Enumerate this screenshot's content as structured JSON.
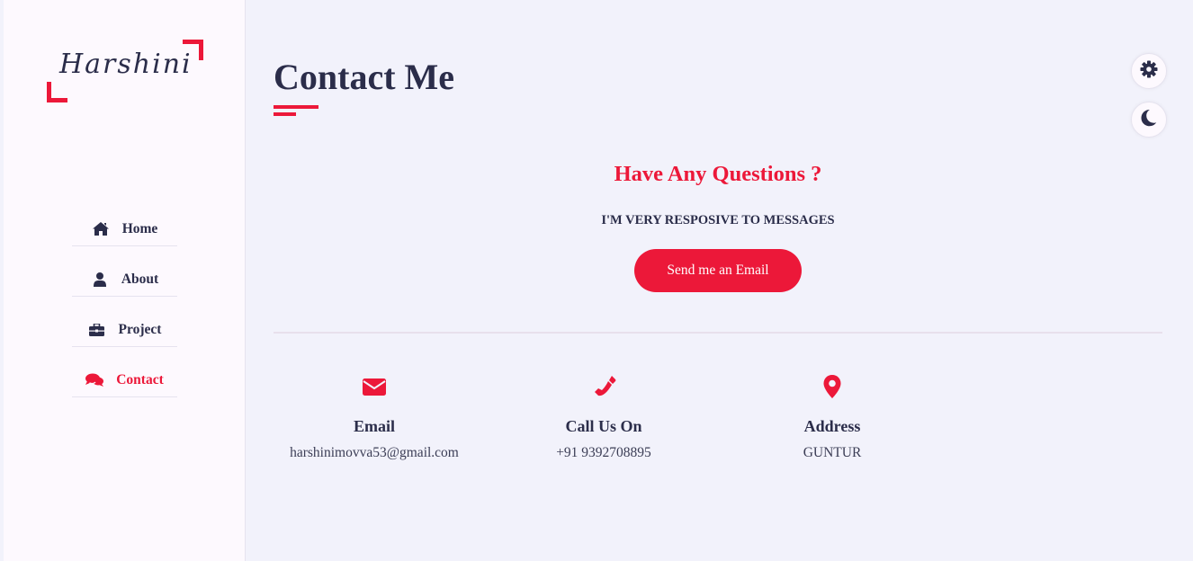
{
  "brand": {
    "logo_text": "Harshini"
  },
  "sidebar": {
    "items": [
      {
        "label": "Home",
        "icon": "home-icon"
      },
      {
        "label": "About",
        "icon": "user-icon"
      },
      {
        "label": "Project",
        "icon": "briefcase-icon"
      },
      {
        "label": "Contact",
        "icon": "comments-icon",
        "active": true
      }
    ]
  },
  "main": {
    "title": "Contact Me",
    "questions_heading": "Have Any Questions ?",
    "responsive_text": "I'M VERY RESPOSIVE TO MESSAGES",
    "email_button_label": "Send me an Email",
    "contacts": [
      {
        "label": "Email",
        "value": "harshinimovva53@gmail.com",
        "icon": "envelope-icon"
      },
      {
        "label": "Call Us On",
        "value": "+91 9392708895",
        "icon": "phone-icon"
      },
      {
        "label": "Address",
        "value": "GUNTUR",
        "icon": "map-pin-icon"
      }
    ]
  },
  "floating": {
    "settings_icon": "gear-icon",
    "theme_icon": "moon-icon"
  },
  "colors": {
    "accent": "#ec1839",
    "text_dark": "#2b2d4a",
    "background": "#f2f2fb",
    "sidebar_background": "#fdf9fe"
  }
}
